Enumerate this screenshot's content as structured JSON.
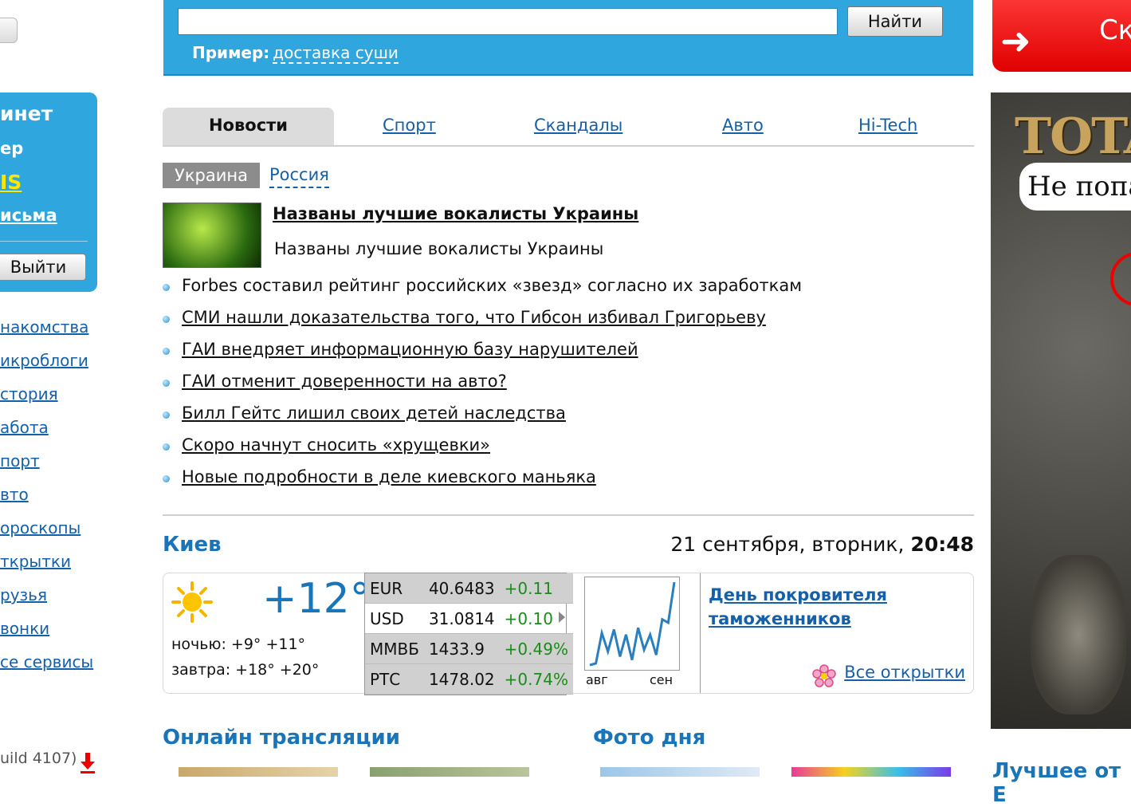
{
  "left": {
    "account": {
      "title_fragment": "инет",
      "line2_fragment": "ер",
      "highlight_fragment": "IS",
      "mail_fragment": "исьма",
      "logout_label": "Выйти"
    },
    "services": [
      "накомства",
      "икроблоги",
      "стория",
      "абота",
      "порт",
      "вто",
      "ороскопы",
      "ткрытки",
      "рузья",
      "вонки",
      "се сервисы"
    ],
    "build_text": "uild 4107)"
  },
  "search": {
    "button_label": "Найти",
    "example_label": "Пример",
    "example_colon": ":",
    "example_value": "доставка суши"
  },
  "red_banner": {
    "text_fragment": "Ск"
  },
  "ad": {
    "title_fragment": "TOTAL",
    "bubble_fragment": "Не попа"
  },
  "tabs": [
    {
      "label": "Новости",
      "active": true
    },
    {
      "label": "Спорт"
    },
    {
      "label": "Скандалы"
    },
    {
      "label": "Авто"
    },
    {
      "label": "Hi-Tech"
    }
  ],
  "region": {
    "active": "Украина",
    "other": "Россия"
  },
  "top_story": {
    "title": "Названы лучшие вокалисты Украины",
    "lead": "Названы лучшие вокалисты Украины"
  },
  "news": [
    {
      "text": "Forbes составил рейтинг российских «звезд» согласно их заработкам",
      "underlined": false
    },
    {
      "text": "СМИ нашли доказательства того, что Гибсон избивал Григорьеву",
      "underlined": true
    },
    {
      "text": "ГАИ внедряет информационную базу нарушителей",
      "underlined": true
    },
    {
      "text": "ГАИ отменит доверенности на авто?",
      "underlined": true
    },
    {
      "text": "Билл Гейтс лишил своих детей наследства",
      "underlined": true
    },
    {
      "text": "Скоро начнут сносить «хрущевки»",
      "underlined": true
    },
    {
      "text": "Новые подробности в деле киевского маньяка",
      "underlined": true
    }
  ],
  "city": "Киев",
  "datetime": {
    "date": "21 сентября, вторник,",
    "time": "20:48"
  },
  "weather": {
    "temp": "+12°",
    "night": "ночью: +9° +11°",
    "tomorrow": "завтра: +18° +20°"
  },
  "rates": [
    {
      "name": "EUR",
      "value": "40.6483",
      "delta": "+0.11"
    },
    {
      "name": "USD",
      "value": "31.0814",
      "delta": "+0.10"
    },
    {
      "name": "ММВБ",
      "value": "1433.9",
      "delta": "+0.49%"
    },
    {
      "name": "РТС",
      "value": "1478.02",
      "delta": "+0.74%"
    }
  ],
  "chart_data": {
    "type": "line",
    "x_labels": [
      "авг",
      "сен"
    ],
    "values": [
      2,
      4,
      40,
      18,
      44,
      12,
      38,
      8,
      46,
      20,
      38,
      14,
      56,
      52,
      100
    ]
  },
  "holiday": {
    "line1": "День покровителя",
    "line2": "таможенников"
  },
  "cards_link": "Все открытки",
  "sections": {
    "online": "Онлайн трансляции",
    "photo": "Фото дня",
    "best_fragment": "Лучшее от Е"
  },
  "colors": {
    "brand_blue": "#2fa6de",
    "link_blue": "#1560a8",
    "heading_blue": "#1a75b8",
    "positive_green": "#1c8a1c",
    "banner_red": "#e00000"
  },
  "icons": [
    "sun-icon",
    "flower-icon",
    "arrow-right-icon",
    "down-arrow-icon",
    "bullet-icon"
  ]
}
